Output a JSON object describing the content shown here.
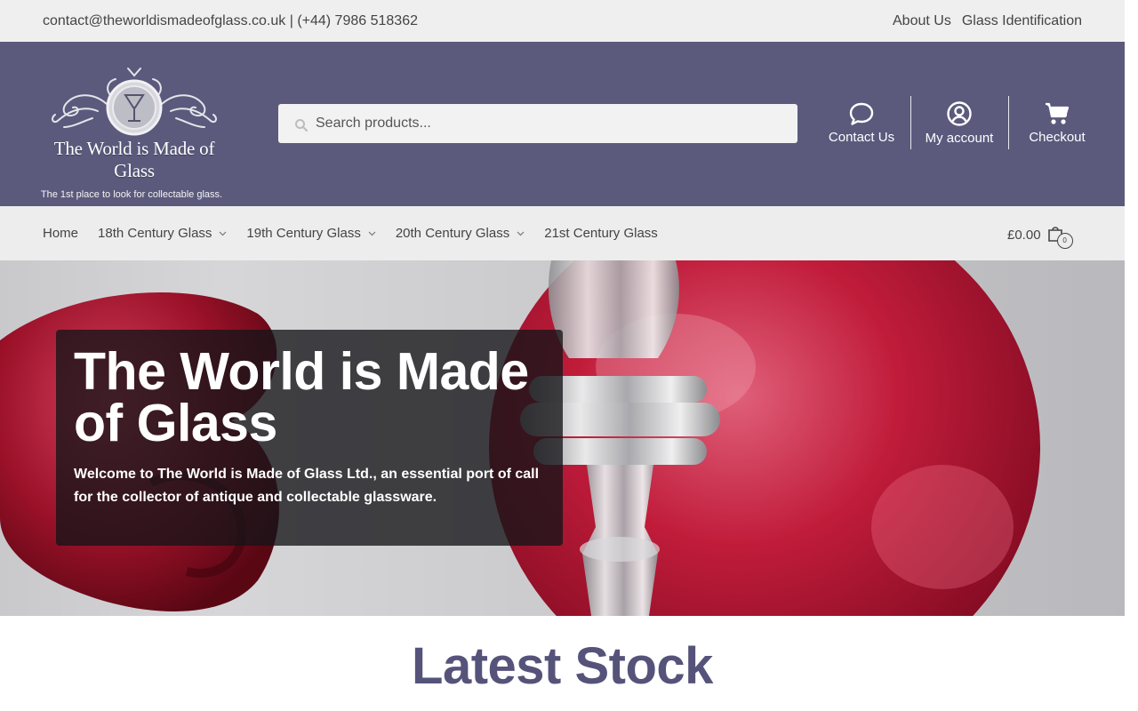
{
  "topbar": {
    "contact": "contact@theworldismadeofglass.co.uk | (+44) 7986 518362",
    "links": [
      "About Us",
      "Glass Identification"
    ]
  },
  "header": {
    "bg_color": "#5b5a7d",
    "logo_title": "The World is Made of Glass",
    "tagline": "The 1st place to look for collectable glass.",
    "search_placeholder": "Search products...",
    "actions": [
      {
        "label": "Contact Us",
        "icon": "chat-bubble-icon"
      },
      {
        "label": "My account",
        "icon": "user-icon"
      },
      {
        "label": "Checkout",
        "icon": "cart-icon"
      }
    ]
  },
  "nav": {
    "items": [
      {
        "label": "Home",
        "has_dropdown": false
      },
      {
        "label": "18th Century Glass",
        "has_dropdown": true
      },
      {
        "label": "19th Century Glass",
        "has_dropdown": true
      },
      {
        "label": "20th Century Glass",
        "has_dropdown": true
      },
      {
        "label": "21st Century Glass",
        "has_dropdown": false
      }
    ],
    "cart_total": "£0.00",
    "cart_count": "0"
  },
  "hero": {
    "title": "The World is Made of Glass",
    "text": "Welcome to The World is Made of Glass Ltd., an essential port of call for the collector of antique and collectable glassware."
  },
  "latest_heading": "Latest Stock",
  "colors": {
    "accent": "#55537a",
    "topbar": "#efefef",
    "navbar": "#ededed"
  }
}
